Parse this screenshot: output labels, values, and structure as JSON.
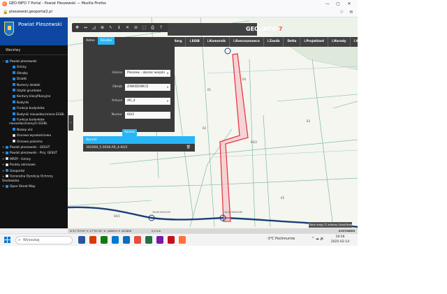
{
  "browser": {
    "window_title": "GEO-INFO 7 Portal - Powiat Pleszewski — Mozilla Firefox",
    "url": "pleszewski.geoportal2.pl",
    "minimize": "—",
    "maximize": "▢",
    "close": "✕",
    "lock_icon": "🔒",
    "bookmark_icon": "☆",
    "menu_icon": "≡"
  },
  "sidebar": {
    "title": "Powiat Pleszewski",
    "layers_tab": "Warstwy",
    "layers": [
      {
        "label": "Powiat pleszewski",
        "level": 0,
        "expand": "−",
        "checked": true
      },
      {
        "label": "Gminy",
        "level": 1,
        "expand": "",
        "checked": true
      },
      {
        "label": "Obręby",
        "level": 1,
        "expand": "",
        "checked": true
      },
      {
        "label": "Działki",
        "level": 1,
        "expand": "",
        "checked": true
      },
      {
        "label": "Numery działek",
        "level": 1,
        "expand": "",
        "checked": true
      },
      {
        "label": "Użytki gruntowe",
        "level": 1,
        "expand": "",
        "checked": true
      },
      {
        "label": "Kontury klasyfikacyjne",
        "level": 1,
        "expand": "",
        "checked": true
      },
      {
        "label": "Budynki",
        "level": 1,
        "expand": "",
        "checked": true
      },
      {
        "label": "Funkcje budynków",
        "level": 1,
        "expand": "",
        "checked": true
      },
      {
        "label": "Budynki nieuwidocznione EGiBL",
        "level": 1,
        "expand": "",
        "checked": true
      },
      {
        "label": "Funkcje budynków nieuwidocznionych EGiBL",
        "level": 1,
        "expand": "",
        "checked": true,
        "tall": true
      },
      {
        "label": "Nazwy ulic",
        "level": 1,
        "expand": "",
        "checked": true
      },
      {
        "label": "Osnowa wysokościowa",
        "level": 1,
        "expand": "",
        "checked": false
      },
      {
        "label": "Osnowa pozioma",
        "level": 1,
        "expand": "",
        "checked": false
      },
      {
        "label": "Powiat pleszewski - GESUT",
        "level": 0,
        "expand": "+",
        "checked": true
      },
      {
        "label": "Powiat pleszewski - Proj. GESUT",
        "level": 0,
        "expand": "+",
        "checked": true
      },
      {
        "label": "MPZP - Gminy",
        "level": 0,
        "expand": "+",
        "checked": false
      },
      {
        "label": "Punkty adresowe",
        "level": 0,
        "expand": "+",
        "checked": false
      },
      {
        "label": "Geoportal",
        "level": 0,
        "expand": "+",
        "checked": true
      },
      {
        "label": "Generalna Dyrekcja Ochrony Środowiska",
        "level": 0,
        "expand": "+",
        "checked": false,
        "tall": true
      },
      {
        "label": "Open Street Map",
        "level": 0,
        "expand": "+",
        "checked": true
      }
    ]
  },
  "toolbar": {
    "icons": [
      "move-icon",
      "ruler-icon",
      "area-icon",
      "zoom-in-icon",
      "pointer-icon",
      "info-icon",
      "crosshair-icon",
      "zoom-out-icon",
      "zoom-box-icon",
      "print-icon",
      "help-icon"
    ],
    "glyphs": [
      "✥",
      "↔",
      "◿",
      "⊕",
      "↖",
      "ℹ",
      "✕",
      "⊖",
      "⬚",
      "⎙",
      "?"
    ]
  },
  "header": {
    "logo_main": "GEO-INFO",
    "logo_num": " 7",
    "logo_sub": "Portal",
    "nav": [
      "i.Kerg",
      "i.EGiB",
      "i.Komornik",
      "i.Rzeczoznawca",
      "i.Zasób",
      "Delta",
      "i.Projektant",
      "i.Narady",
      "i.Wniosek"
    ]
  },
  "search_panel": {
    "tabs": [
      "Adres",
      "Działka"
    ],
    "active_tab": 1,
    "fields": [
      {
        "label": "Gmina",
        "value": "Pleszew - obszar wiejski"
      },
      {
        "label": "Obręb",
        "value": "ZAWIDOWICE"
      },
      {
        "label": "Arkusz",
        "value": "AR_4"
      },
      {
        "label": "Numer",
        "value": "60/2"
      }
    ],
    "button": "Szukaj",
    "results_title": "Wyniki",
    "result_row": "302006_5.0028.AR_4.60/2",
    "trash_icon": "🗑"
  },
  "map": {
    "parcel_labels": [
      "60/2",
      "61",
      "62",
      "60/1",
      "63",
      "64",
      "65"
    ],
    "point_labels": [
      "300619002090",
      "300619002089"
    ],
    "attribution": "Dane mapy © autorzy OpenStreetMap"
  },
  "status": {
    "coords": "N 51°53'55\" E 17°52'45\"  X: 448034  Y: 402808",
    "scale": "0,2 km",
    "brand": "SYSTHERM"
  },
  "taskbar": {
    "search_placeholder": "Wyszukaj",
    "weather": "-3°C  Pochmurnie",
    "tray": "^  ☁  🔊",
    "time": "19:56",
    "date": "2025-02-14",
    "app_colors": [
      "#2b579a",
      "#d83b01",
      "#107c10",
      "#0078d4",
      "#0f6cbd",
      "#e74c3c",
      "#217346",
      "#7719aa",
      "#c50f1f",
      "#ff7139"
    ]
  }
}
